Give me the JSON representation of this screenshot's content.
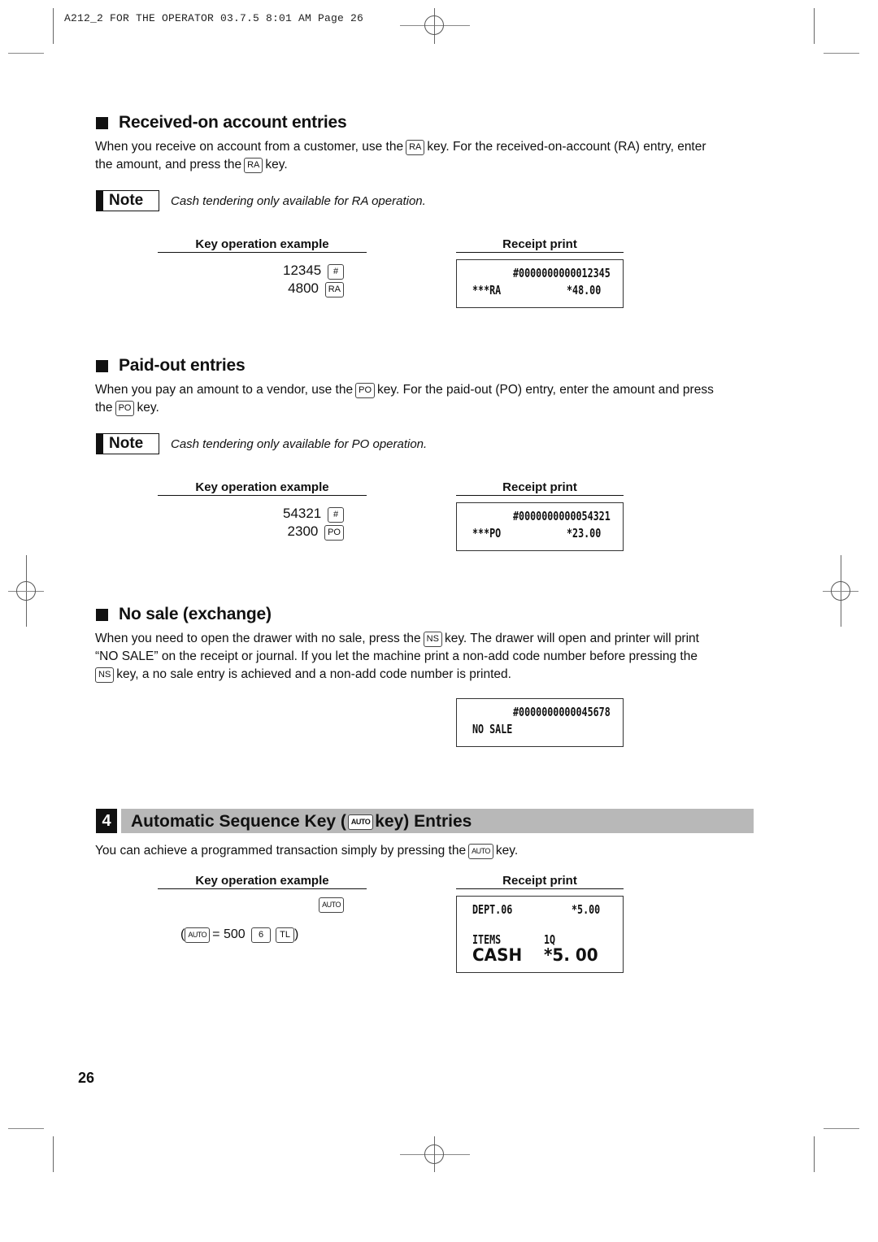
{
  "header": {
    "slug": "A212_2 FOR THE OPERATOR  03.7.5 8:01 AM  Page 26"
  },
  "sections": {
    "received_on_account": {
      "title": "Received-on account entries",
      "text_1": "When you receive on account from a customer, use the",
      "key_1": "RA",
      "text_2": "key.  For the received-on-account (RA) entry, enter",
      "text_3": "the amount, and press the",
      "key_2": "RA",
      "text_4": "key.",
      "note_label": "Note",
      "note_text": "Cash tendering only available for RA operation.",
      "key_op_heading": "Key operation example",
      "receipt_heading": "Receipt print",
      "operations": [
        {
          "value": "12345",
          "key": "#"
        },
        {
          "value": "4800",
          "key": "RA"
        }
      ],
      "receipt_lines": [
        {
          "left": "",
          "right": "#0000000000012345"
        },
        {
          "left": "***RA",
          "right": "*48.00"
        }
      ]
    },
    "paid_out": {
      "title": "Paid-out entries",
      "text_1": "When you pay an amount to a vendor, use the",
      "key_1": "PO",
      "text_2": "key.  For the paid-out (PO) entry, enter the amount and press",
      "text_3": "the",
      "key_2": "PO",
      "text_4": "key.",
      "note_label": "Note",
      "note_text": "Cash tendering only available for PO operation.",
      "key_op_heading": "Key operation example",
      "receipt_heading": "Receipt print",
      "operations": [
        {
          "value": "54321",
          "key": "#"
        },
        {
          "value": "2300",
          "key": "PO"
        }
      ],
      "receipt_lines": [
        {
          "left": "",
          "right": "#0000000000054321"
        },
        {
          "left": "***PO",
          "right": "*23.00"
        }
      ]
    },
    "no_sale": {
      "title": "No sale (exchange)",
      "text_1": "When you need to open the drawer with no sale, press the",
      "key_1": "NS",
      "text_2": "key.  The drawer will open and printer will print",
      "text_3": "“NO SALE” on the receipt or journal.  If you let the machine print a non-add code number before pressing the",
      "key_2": "NS",
      "text_4": "key, a no sale entry is achieved and a non-add code number is printed.",
      "receipt_lines": [
        {
          "left": "",
          "right": "#0000000000045678"
        },
        {
          "left": "NO SALE",
          "right": ""
        }
      ]
    },
    "auto_key": {
      "number": "4",
      "title_1": "Automatic Sequence Key (",
      "title_key": "AUTO",
      "title_2": "key) Entries",
      "text_1": "You can achieve a programmed transaction simply by pressing the",
      "key_1": "AUTO",
      "text_2": "key.",
      "key_op_heading": "Key operation example",
      "receipt_heading": "Receipt print",
      "operation_key": "AUTO",
      "definition": {
        "open": "(",
        "key": "AUTO",
        "equals": "= 500",
        "dept_key": "6",
        "total_key": "TL",
        "close": ")"
      },
      "receipt_lines": [
        {
          "left": "DEPT.06",
          "right": "*5.00"
        },
        {
          "left": "ITEMS",
          "right": "1Q"
        },
        {
          "left": "CASH",
          "right": "*5. 00"
        }
      ]
    }
  },
  "footer": {
    "page_number": "26"
  }
}
